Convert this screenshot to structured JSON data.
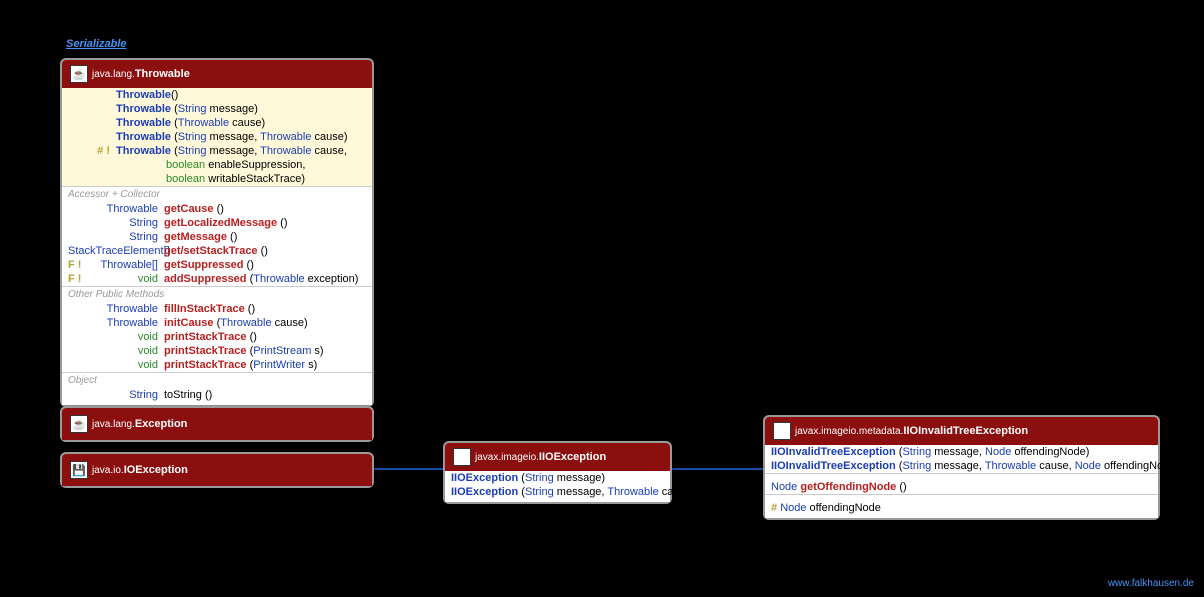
{
  "interface_label": "Serializable",
  "footer": "www.falkhausen.de",
  "throwable": {
    "pkg": "java.lang.",
    "name": "Throwable",
    "icon": "☕",
    "ctors": [
      {
        "name": "Throwable",
        "params": "()"
      },
      {
        "name": "Throwable",
        "params_open": "(",
        "p1_type": "String",
        "p1_name": " message)",
        "full": "(String message)"
      },
      {
        "name": "Throwable",
        "params_open": "(",
        "p1_type": "Throwable",
        "p1_name": " cause)"
      },
      {
        "name": "Throwable",
        "params_open": "(",
        "p1_type": "String",
        "p1_name": " message, ",
        "p2_type": "Throwable",
        "p2_name": " cause)"
      },
      {
        "mod": "# !",
        "name": "Throwable",
        "params_open": "(",
        "p1_type": "String",
        "p1_name": " message, ",
        "p2_type": "Throwable",
        "p2_name": " cause,"
      }
    ],
    "ctor_extra": [
      {
        "p_type": "boolean",
        "p_name": " enableSuppression,"
      },
      {
        "p_type": "boolean",
        "p_name": " writableStackTrace)"
      }
    ],
    "sec1_label": "Accessor + Collector",
    "accessors": [
      {
        "ret": "Throwable",
        "name": "getCause",
        "params": " ()"
      },
      {
        "ret": "String",
        "name": "getLocalizedMessage",
        "params": " ()"
      },
      {
        "ret": "String",
        "name": "getMessage",
        "params": " ()"
      },
      {
        "ret": "StackTraceElement[]",
        "name": "get/setStackTrace",
        "params": " ()",
        "wide": true
      },
      {
        "mod": "F !",
        "ret": "Throwable[]",
        "name": "getSuppressed",
        "params": " ()"
      },
      {
        "mod": "F !",
        "ret": "void",
        "name": "addSuppressed",
        "params_open": " (",
        "p1_type": "Throwable",
        "p1_name": " exception)"
      }
    ],
    "sec2_label": "Other Public Methods",
    "methods": [
      {
        "ret": "Throwable",
        "name": "fillInStackTrace",
        "params": " ()"
      },
      {
        "ret": "Throwable",
        "name": "initCause",
        "params_open": " (",
        "p1_type": "Throwable",
        "p1_name": " cause)"
      },
      {
        "ret": "void",
        "name": "printStackTrace",
        "params": " ()"
      },
      {
        "ret": "void",
        "name": "printStackTrace",
        "params_open": " (",
        "p1_type": "PrintStream",
        "p1_name": " s)"
      },
      {
        "ret": "void",
        "name": "printStackTrace",
        "params_open": " (",
        "p1_type": "PrintWriter",
        "p1_name": " s)"
      }
    ],
    "sec3_label": "Object",
    "obj_methods": [
      {
        "ret": "String",
        "name": "toString",
        "params": " ()",
        "black": true
      }
    ]
  },
  "exception": {
    "pkg": "java.lang.",
    "name": "Exception",
    "icon": "☕"
  },
  "ioexception": {
    "pkg": "java.io.",
    "name": "IOException",
    "icon": "💾"
  },
  "iioexception": {
    "pkg": "javax.imageio.",
    "name": "IIOException",
    "icon": "🖼",
    "ctors": [
      {
        "name": "IIOException",
        "params_open": " (",
        "p1_type": "String",
        "p1_name": " message)"
      },
      {
        "name": "IIOException",
        "params_open": " (",
        "p1_type": "String",
        "p1_name": " message, ",
        "p2_type": "Throwable",
        "p2_name": " cause)"
      }
    ]
  },
  "iioinvalid": {
    "pkg": "javax.imageio.metadata.",
    "name": "IIOInvalidTreeException",
    "icon": "🖼",
    "ctors": [
      {
        "name": "IIOInvalidTreeException",
        "params_open": " (",
        "p1_type": "String",
        "p1_name": " message, ",
        "p2_type": "Node",
        "p2_name": " offendingNode)"
      },
      {
        "name": "IIOInvalidTreeException",
        "params_open": " (",
        "p1_type": "String",
        "p1_name": " message, ",
        "p2_type": "Throwable",
        "p2_name": " cause, ",
        "p3_type": "Node",
        "p3_name": " offendingNode)"
      }
    ],
    "method": {
      "ret": "Node",
      "name": "getOffendingNode",
      "params": " ()"
    },
    "field": {
      "mod": "#",
      "ret": "Node",
      "name": "offendingNode"
    }
  }
}
